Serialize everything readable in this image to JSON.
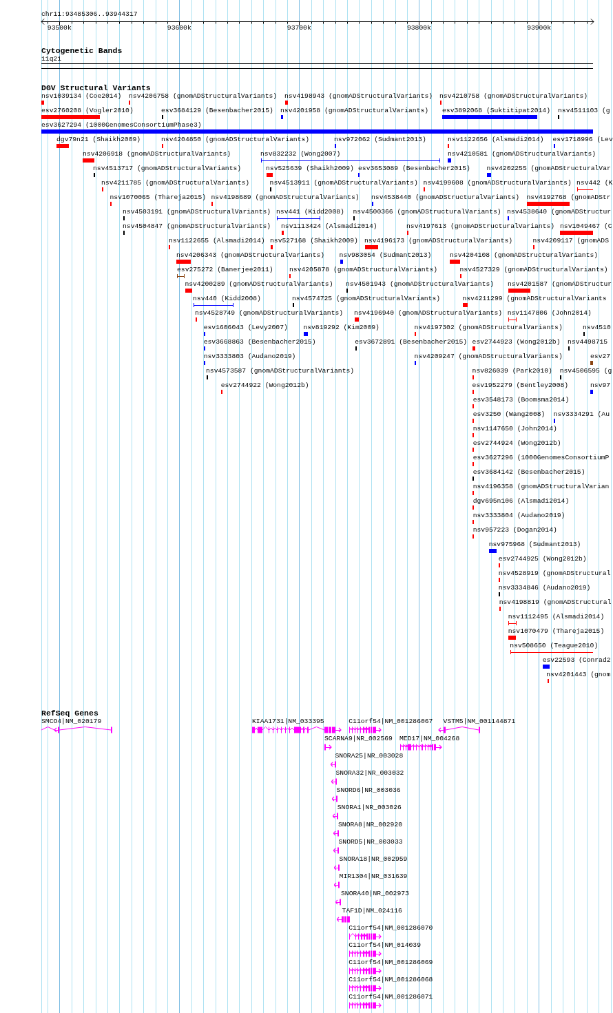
{
  "ruler": {
    "range": "chr11:93485306..93944317",
    "ticks": [
      "93500k",
      "93600k",
      "93700k",
      "93800k",
      "93900k"
    ]
  },
  "cytogenetic_bands": {
    "title": "Cytogenetic Bands",
    "bands": [
      {
        "label": "11q21"
      }
    ]
  },
  "dgv_structural_variants": {
    "title": "DGV Structural Variants",
    "rows": [
      {
        "features": [
          {
            "label": "nsv1039134 (Coe2014)",
            "color": "#ff0000",
            "kind": "bar"
          },
          {
            "label": "nsv4206758 (gnomADStructuralVariants)",
            "color": "#ff0000",
            "kind": "bar"
          },
          {
            "label": "nsv4198943 (gnomADStructuralVariants)",
            "color": "#ff0000",
            "kind": "bar"
          },
          {
            "label": "nsv4210758 (gnomADStructuralVariants)",
            "color": "#ff0000",
            "kind": "bar"
          }
        ]
      },
      {
        "features": [
          {
            "label": "esv2760208 (Vogler2010)",
            "color": "#ff0000",
            "kind": "bar"
          },
          {
            "label": "esv3684129 (Besenbacher2015)",
            "color": "#000000",
            "kind": "bar"
          },
          {
            "label": "nsv4201958 (gnomADStructuralVariants)",
            "color": "#0000ff",
            "kind": "bar"
          },
          {
            "label": "esv3892068 (Suktitipat2014)",
            "color": "#0000ff",
            "kind": "bar"
          },
          {
            "label": "nsv4511103 (g",
            "color": "#000000",
            "kind": "bar"
          }
        ]
      },
      {
        "features": [
          {
            "label": "esv3627294 (1000GenomesConsortiumPhase3)",
            "color": "#0000ff",
            "kind": "bar"
          }
        ]
      },
      {
        "features": [
          {
            "label": "dgv79n21 (Shaikh2009)",
            "color": "#ff0000",
            "kind": "bar"
          },
          {
            "label": "nsv4204850 (gnomADStructuralVariants)",
            "color": "#ff0000",
            "kind": "bar"
          },
          {
            "label": "nsv972062 (Sudmant2013)",
            "color": "#0000ff",
            "kind": "bar"
          },
          {
            "label": "nsv1122656 (Alsmadi2014)",
            "color": "#ff0000",
            "kind": "bar"
          },
          {
            "label": "esv1718996 (Lev",
            "color": "#0000ff",
            "kind": "bar"
          }
        ]
      },
      {
        "features": [
          {
            "label": "nsv4206918 (gnomADStructuralVariants)",
            "color": "#ff0000",
            "kind": "bar"
          },
          {
            "label": "nsv832232 (Wong2007)",
            "color": "#0000ff",
            "kind": "span"
          },
          {
            "label": "nsv4210581 (gnomADStructuralVariants)",
            "color": "#0000ff",
            "kind": "bar"
          }
        ]
      },
      {
        "features": [
          {
            "label": "nsv4513717 (gnomADStructuralVariants)",
            "color": "#000000",
            "kind": "bar"
          },
          {
            "label": "nsv525639 (Shaikh2009)",
            "color": "#ff0000",
            "kind": "bar"
          },
          {
            "label": "esv3653089 (Besenbacher2015)",
            "color": "#0000ff",
            "kind": "bar"
          },
          {
            "label": "nsv4202255 (gnomADStructuralVar",
            "color": "#0000ff",
            "kind": "bar"
          }
        ]
      },
      {
        "features": [
          {
            "label": "nsv4211785 (gnomADStructuralVariants)",
            "color": "#ff0000",
            "kind": "bar"
          },
          {
            "label": "nsv4513911 (gnomADStructuralVariants)",
            "color": "#000000",
            "kind": "bar"
          },
          {
            "label": "nsv4199608 (gnomADStructuralVariants)",
            "color": "#ff0000",
            "kind": "bar"
          },
          {
            "label": "nsv442 (K",
            "color": "#ff0000",
            "kind": "span"
          }
        ]
      },
      {
        "features": [
          {
            "label": "nsv1070065 (Thareja2015)",
            "color": "#ff0000",
            "kind": "bar"
          },
          {
            "label": "nsv4198689 (gnomADStructuralVariants)",
            "color": "#ff0000",
            "kind": "bar"
          },
          {
            "label": "nsv4538440 (gnomADStructuralVariants)",
            "color": "#0000ff",
            "kind": "bar"
          },
          {
            "label": "nsv4192768 (gnomADStr",
            "color": "#ff0000",
            "kind": "bar"
          }
        ]
      },
      {
        "features": [
          {
            "label": "nsv4503191 (gnomADStructuralVariants)",
            "color": "#000000",
            "kind": "bar"
          },
          {
            "label": "nsv441 (Kidd2008)",
            "color": "#0000ff",
            "kind": "span"
          },
          {
            "label": "nsv4500366 (gnomADStructuralVariants)",
            "color": "#000000",
            "kind": "bar"
          },
          {
            "label": "nsv4538640 (gnomADStructur",
            "color": "#0000ff",
            "kind": "bar"
          }
        ]
      },
      {
        "features": [
          {
            "label": "nsv4504847 (gnomADStructuralVariants)",
            "color": "#000000",
            "kind": "bar"
          },
          {
            "label": "nsv1113424 (Alsmadi2014)",
            "color": "#ff0000",
            "kind": "bar"
          },
          {
            "label": "nsv4197613 (gnomADStructuralVariants)",
            "color": "#ff0000",
            "kind": "bar"
          },
          {
            "label": "nsv1049467 (C",
            "color": "#ff0000",
            "kind": "bar"
          }
        ]
      },
      {
        "features": [
          {
            "label": "nsv1122655 (Alsmadi2014)",
            "color": "#ff0000",
            "kind": "bar"
          },
          {
            "label": "nsv527168 (Shaikh2009)",
            "color": "#ff0000",
            "kind": "bar"
          },
          {
            "label": "nsv4196173 (gnomADStructuralVariants)",
            "color": "#ff0000",
            "kind": "bar"
          },
          {
            "label": "nsv4209117 (gnomADS",
            "color": "#ff0000",
            "kind": "bar"
          }
        ]
      },
      {
        "features": [
          {
            "label": "nsv4206343 (gnomADStructuralVariants)",
            "color": "#ff0000",
            "kind": "bar"
          },
          {
            "label": "nsv983054 (Sudmant2013)",
            "color": "#0000ff",
            "kind": "bar"
          },
          {
            "label": "nsv4204108 (gnomADStructuralVariants)",
            "color": "#ff0000",
            "kind": "bar"
          }
        ]
      },
      {
        "features": [
          {
            "label": "esv275272 (Banerjee2011)",
            "color": "#8b4513",
            "kind": "span"
          },
          {
            "label": "nsv4205878 (gnomADStructuralVariants)",
            "color": "#ff0000",
            "kind": "bar"
          },
          {
            "label": "nsv4527329 (gnomADStructuralVariants)",
            "color": "#ff0000",
            "kind": "bar"
          }
        ]
      },
      {
        "features": [
          {
            "label": "nsv4200289 (gnomADStructuralVariants)",
            "color": "#ff0000",
            "kind": "bar"
          },
          {
            "label": "nsv4501943 (gnomADStructuralVariants)",
            "color": "#000000",
            "kind": "bar"
          },
          {
            "label": "nsv4201587 (gnomADStructur",
            "color": "#ff0000",
            "kind": "bar"
          }
        ]
      },
      {
        "features": [
          {
            "label": "nsv440 (Kidd2008)",
            "color": "#0000ff",
            "kind": "span"
          },
          {
            "label": "nsv4574725 (gnomADStructuralVariants)",
            "color": "#000000",
            "kind": "bar"
          },
          {
            "label": "nsv4211299 (gnomADStructuralVariants",
            "color": "#ff0000",
            "kind": "bar"
          }
        ]
      },
      {
        "features": [
          {
            "label": "nsv4528749 (gnomADStructuralVariants)",
            "color": "#ff0000",
            "kind": "bar"
          },
          {
            "label": "nsv4196940 (gnomADStructuralVariants)",
            "color": "#ff0000",
            "kind": "bar"
          },
          {
            "label": "nsv1147806 (John2014)",
            "color": "#ff0000",
            "kind": "span"
          }
        ]
      },
      {
        "features": [
          {
            "label": "esv1606043 (Levy2007)",
            "color": "#0000ff",
            "kind": "bar"
          },
          {
            "label": "nsv819292 (Kim2009)",
            "color": "#0000ff",
            "kind": "bar"
          },
          {
            "label": "nsv4197302 (gnomADStructuralVariants)",
            "color": "#ff0000",
            "kind": "bar"
          },
          {
            "label": "nsv4510",
            "color": "#000000",
            "kind": "bar"
          }
        ]
      },
      {
        "features": [
          {
            "label": "esv3668863 (Besenbacher2015)",
            "color": "#0000ff",
            "kind": "bar"
          },
          {
            "label": "esv3672891 (Besenbacher2015)",
            "color": "#000000",
            "kind": "bar"
          },
          {
            "label": "esv2744923 (Wong2012b)",
            "color": "#ff0000",
            "kind": "bar"
          },
          {
            "label": "nsv4498715",
            "color": "#000000",
            "kind": "bar"
          }
        ]
      },
      {
        "features": [
          {
            "label": "nsv3333803 (Audano2019)",
            "color": "#0000ff",
            "kind": "bar"
          },
          {
            "label": "nsv4209247 (gnomADStructuralVariants)",
            "color": "#0000ff",
            "kind": "bar"
          },
          {
            "label": "esv27",
            "color": "#8b4513",
            "kind": "bar"
          }
        ]
      },
      {
        "features": [
          {
            "label": "nsv4573587 (gnomADStructuralVariants)",
            "color": "#000000",
            "kind": "bar"
          },
          {
            "label": "nsv826039 (Park2010)",
            "color": "#ff0000",
            "kind": "bar"
          },
          {
            "label": "nsv4506595 (g",
            "color": "#000000",
            "kind": "bar"
          }
        ]
      },
      {
        "features": [
          {
            "label": "esv2744922 (Wong2012b)",
            "color": "#ff0000",
            "kind": "bar"
          },
          {
            "label": "esv1952279 (Bentley2008)",
            "color": "#ff0000",
            "kind": "bar"
          },
          {
            "label": "nsv97",
            "color": "#0000ff",
            "kind": "bar"
          }
        ]
      },
      {
        "features": [
          {
            "label": "esv3548173 (Boomsma2014)",
            "color": "#ff0000",
            "kind": "bar"
          }
        ]
      },
      {
        "features": [
          {
            "label": "esv3250 (Wang2008)",
            "color": "#ff0000",
            "kind": "bar"
          },
          {
            "label": "nsv3334291 (Au",
            "color": "#0000ff",
            "kind": "bar"
          }
        ]
      },
      {
        "features": [
          {
            "label": "nsv1147650 (John2014)",
            "color": "#ff0000",
            "kind": "bar"
          }
        ]
      },
      {
        "features": [
          {
            "label": "esv2744924 (Wong2012b)",
            "color": "#ff0000",
            "kind": "bar"
          }
        ]
      },
      {
        "features": [
          {
            "label": "esv3627296 (1000GenomesConsortiumP",
            "color": "#ff0000",
            "kind": "bar"
          }
        ]
      },
      {
        "features": [
          {
            "label": "esv3684142 (Besenbacher2015)",
            "color": "#000000",
            "kind": "bar"
          }
        ]
      },
      {
        "features": [
          {
            "label": "nsv4196358 (gnomADStructuralVarian",
            "color": "#ff0000",
            "kind": "bar"
          }
        ]
      },
      {
        "features": [
          {
            "label": "dgv695n106 (Alsmadi2014)",
            "color": "#ff0000",
            "kind": "bar"
          }
        ]
      },
      {
        "features": [
          {
            "label": "nsv3333804 (Audano2019)",
            "color": "#ff0000",
            "kind": "bar"
          }
        ]
      },
      {
        "features": [
          {
            "label": "nsv957223 (Dogan2014)",
            "color": "#ff0000",
            "kind": "bar"
          }
        ]
      },
      {
        "features": [
          {
            "label": "nsv975968 (Sudmant2013)",
            "color": "#0000ff",
            "kind": "bar"
          }
        ]
      },
      {
        "features": [
          {
            "label": "esv2744925 (Wong2012b)",
            "color": "#ff0000",
            "kind": "bar"
          }
        ]
      },
      {
        "features": [
          {
            "label": "nsv4528919 (gnomADStructural",
            "color": "#ff0000",
            "kind": "bar"
          }
        ]
      },
      {
        "features": [
          {
            "label": "nsv3334846 (Audano2019)",
            "color": "#000000",
            "kind": "bar"
          }
        ]
      },
      {
        "features": [
          {
            "label": "nsv4198819 (gnomADStructural",
            "color": "#ff0000",
            "kind": "bar"
          }
        ]
      },
      {
        "features": [
          {
            "label": "nsv1112495 (Alsmadi2014)",
            "color": "#ff0000",
            "kind": "span"
          }
        ]
      },
      {
        "features": [
          {
            "label": "nsv1070479 (Thareja2015)",
            "color": "#ff0000",
            "kind": "bar"
          }
        ]
      },
      {
        "features": [
          {
            "label": "nsv508650 (Teague2010)",
            "color": "#ff0000",
            "kind": "span"
          }
        ]
      },
      {
        "features": [
          {
            "label": "esv22593 (Conrad2",
            "color": "#0000ff",
            "kind": "bar"
          }
        ]
      },
      {
        "features": [
          {
            "label": "nsv4201443 (gnom",
            "color": "#ff0000",
            "kind": "bar"
          }
        ]
      }
    ]
  },
  "refseq_genes": {
    "title": "RefSeq Genes",
    "rows": [
      {
        "genes": [
          {
            "label": "SMCO4|NM_020179",
            "reverse_strand": true
          },
          {
            "label": "KIAA1731|NM_033395",
            "reverse_strand": false
          },
          {
            "label": "C11orf54|NM_001286067",
            "reverse_strand": false
          },
          {
            "label": "VSTM5|NM_001144871",
            "reverse_strand": true
          }
        ]
      },
      {
        "genes": [
          {
            "label": "SCARNA9|NR_002569",
            "reverse_strand": false
          },
          {
            "label": "MED17|NM_004268",
            "reverse_strand": false
          }
        ]
      },
      {
        "genes": [
          {
            "label": "SNORA25|NR_003028",
            "reverse_strand": true
          }
        ]
      },
      {
        "genes": [
          {
            "label": "SNORA32|NR_003032",
            "reverse_strand": true
          }
        ]
      },
      {
        "genes": [
          {
            "label": "SNORD6|NR_003036",
            "reverse_strand": true
          }
        ]
      },
      {
        "genes": [
          {
            "label": "SNORA1|NR_003026",
            "reverse_strand": true
          }
        ]
      },
      {
        "genes": [
          {
            "label": "SNORA8|NR_002920",
            "reverse_strand": true
          }
        ]
      },
      {
        "genes": [
          {
            "label": "SNORD5|NR_003033",
            "reverse_strand": true
          }
        ]
      },
      {
        "genes": [
          {
            "label": "SNORA18|NR_002959",
            "reverse_strand": true
          }
        ]
      },
      {
        "genes": [
          {
            "label": "MIR1304|NR_031639",
            "reverse_strand": true
          }
        ]
      },
      {
        "genes": [
          {
            "label": "SNORA40|NR_002973",
            "reverse_strand": true
          }
        ]
      },
      {
        "genes": [
          {
            "label": "TAF1D|NM_024116",
            "reverse_strand": true
          }
        ]
      },
      {
        "genes": [
          {
            "label": "C11orf54|NM_001286070",
            "reverse_strand": false
          }
        ]
      },
      {
        "genes": [
          {
            "label": "C11orf54|NM_014039",
            "reverse_strand": false
          }
        ]
      },
      {
        "genes": [
          {
            "label": "C11orf54|NM_001286069",
            "reverse_strand": false
          }
        ]
      },
      {
        "genes": [
          {
            "label": "C11orf54|NM_001286068",
            "reverse_strand": false
          }
        ]
      },
      {
        "genes": [
          {
            "label": "C11orf54|NM_001286071",
            "reverse_strand": false
          }
        ]
      }
    ]
  }
}
